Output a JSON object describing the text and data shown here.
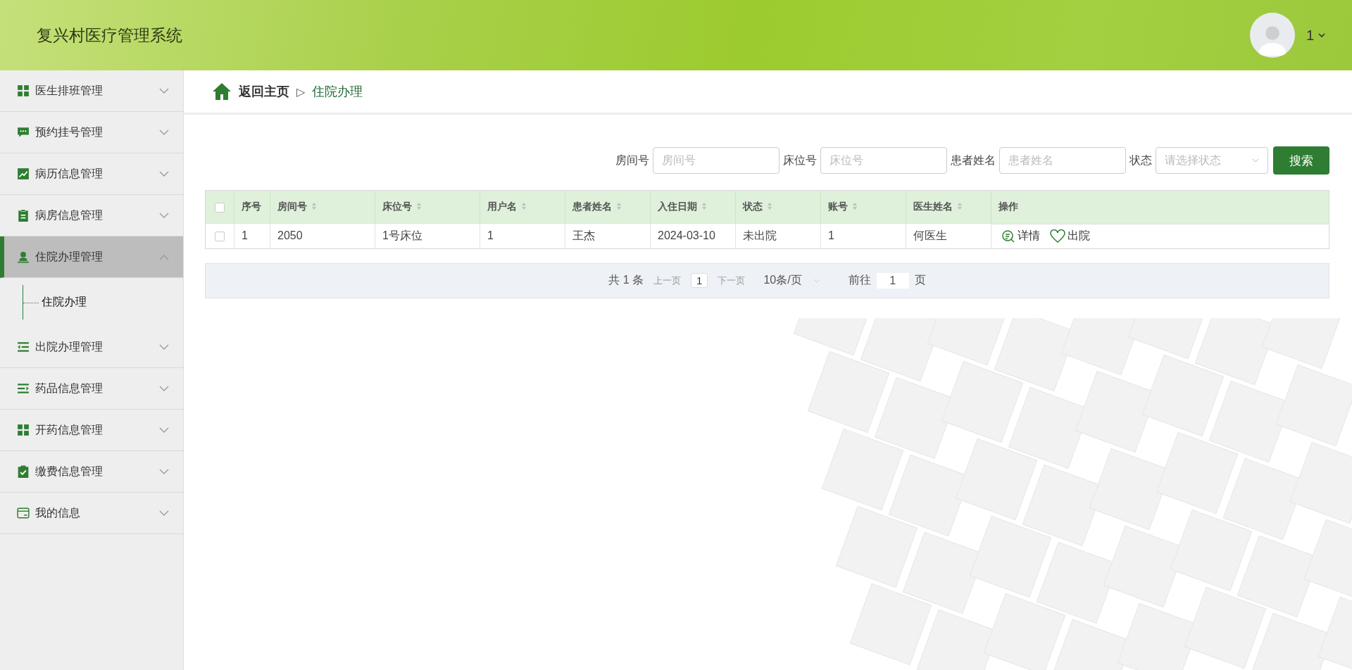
{
  "header": {
    "title": "复兴村医疗管理系统",
    "user": "1"
  },
  "sidebar": {
    "items": [
      {
        "label": "医生排班管理",
        "expanded": false,
        "selected": false
      },
      {
        "label": "预约挂号管理",
        "expanded": false,
        "selected": false
      },
      {
        "label": "病历信息管理",
        "expanded": false,
        "selected": false
      },
      {
        "label": "病房信息管理",
        "expanded": false,
        "selected": false
      },
      {
        "label": "住院办理管理",
        "expanded": true,
        "selected": true,
        "children": [
          {
            "label": "住院办理"
          }
        ]
      },
      {
        "label": "出院办理管理",
        "expanded": false,
        "selected": false
      },
      {
        "label": "药品信息管理",
        "expanded": false,
        "selected": false
      },
      {
        "label": "开药信息管理",
        "expanded": false,
        "selected": false
      },
      {
        "label": "缴费信息管理",
        "expanded": false,
        "selected": false
      },
      {
        "label": "我的信息",
        "expanded": false,
        "selected": false
      }
    ]
  },
  "breadcrumb": {
    "home": "返回主页",
    "separator": "▷",
    "current": "住院办理"
  },
  "search": {
    "fields": [
      {
        "kind": "input",
        "label": "房间号",
        "placeholder": "房间号"
      },
      {
        "kind": "input",
        "label": "床位号",
        "placeholder": "床位号"
      },
      {
        "kind": "input",
        "label": "患者姓名",
        "placeholder": "患者姓名"
      },
      {
        "kind": "select",
        "label": "状态",
        "placeholder": "请选择状态"
      }
    ],
    "button": "搜索"
  },
  "table": {
    "all_checked": false,
    "columns": [
      {
        "label": "序号",
        "sortable": false
      },
      {
        "label": "房间号",
        "sortable": true
      },
      {
        "label": "床位号",
        "sortable": true
      },
      {
        "label": "用户名",
        "sortable": true
      },
      {
        "label": "患者姓名",
        "sortable": true
      },
      {
        "label": "入住日期",
        "sortable": true
      },
      {
        "label": "状态",
        "sortable": true
      },
      {
        "label": "账号",
        "sortable": true
      },
      {
        "label": "医生姓名",
        "sortable": true
      },
      {
        "label": "操作",
        "sortable": false
      }
    ],
    "rows": [
      {
        "checked": false,
        "cells": [
          "1",
          "2050",
          "1号床位",
          "1",
          "王杰",
          "2024-03-10",
          "未出院",
          "1",
          "何医生"
        ],
        "actions": [
          {
            "kind": "details",
            "label": "详情"
          },
          {
            "kind": "discharge",
            "label": "出院"
          }
        ]
      }
    ]
  },
  "pagination": {
    "total": "共 1 条",
    "prev": "上一页",
    "page": "1",
    "next": "下一页",
    "page_size": "10条/页",
    "goto": "前往",
    "goto_value": "1",
    "page_unit": "页"
  }
}
